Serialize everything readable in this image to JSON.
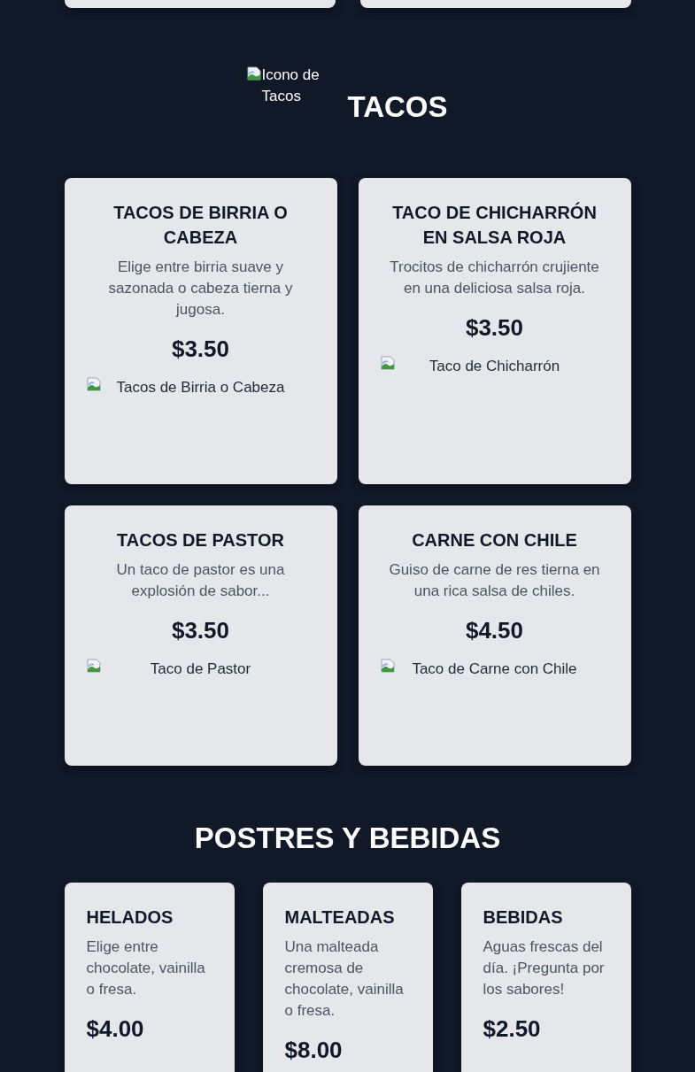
{
  "previous_section": {
    "cards": [
      {
        "kind": "card"
      },
      {
        "kind": "card"
      }
    ]
  },
  "sections": [
    {
      "kind": "centered",
      "title": "TACOS",
      "icon": {
        "alt": "Icono de Tacos"
      },
      "items": [
        {
          "name": "TACOS DE BIRRIA O CABEZA",
          "description": "Elige entre birria suave y sazonada o cabeza tierna y jugosa.",
          "price": "$3.50",
          "image": {
            "alt": "Tacos de Birria o Cabeza"
          }
        },
        {
          "name": "TACO DE CHICHARRÓN EN SALSA ROJA",
          "description": "Trocitos de chicharrón crujiente en una deliciosa salsa roja.",
          "price": "$3.50",
          "image": {
            "alt": "Taco de Chicharrón"
          }
        },
        {
          "name": "TACOS DE PASTOR",
          "description": "Un taco de pastor es una explosión de sabor...",
          "price": "$3.50",
          "image": {
            "alt": "Taco de Pastor"
          }
        },
        {
          "name": "CARNE CON CHILE",
          "description": "Guiso de carne de res tierna en una rica salsa de chiles.",
          "price": "$4.50",
          "image": {
            "alt": "Taco de Carne con Chile"
          }
        }
      ]
    },
    {
      "kind": "compact",
      "title": "POSTRES Y BEBIDAS",
      "items": [
        {
          "name": "HELADOS",
          "description": "Elige entre chocolate, vainilla o fresa.",
          "price": "$4.00"
        },
        {
          "name": "MALTEADAS",
          "description": "Una malteada cremosa de chocolate, vainilla o fresa.",
          "price": "$8.00"
        },
        {
          "name": "BEBIDAS",
          "description": "Aguas frescas del día. ¡Pregunta por los sabores!",
          "price": "$2.50"
        }
      ]
    }
  ]
}
